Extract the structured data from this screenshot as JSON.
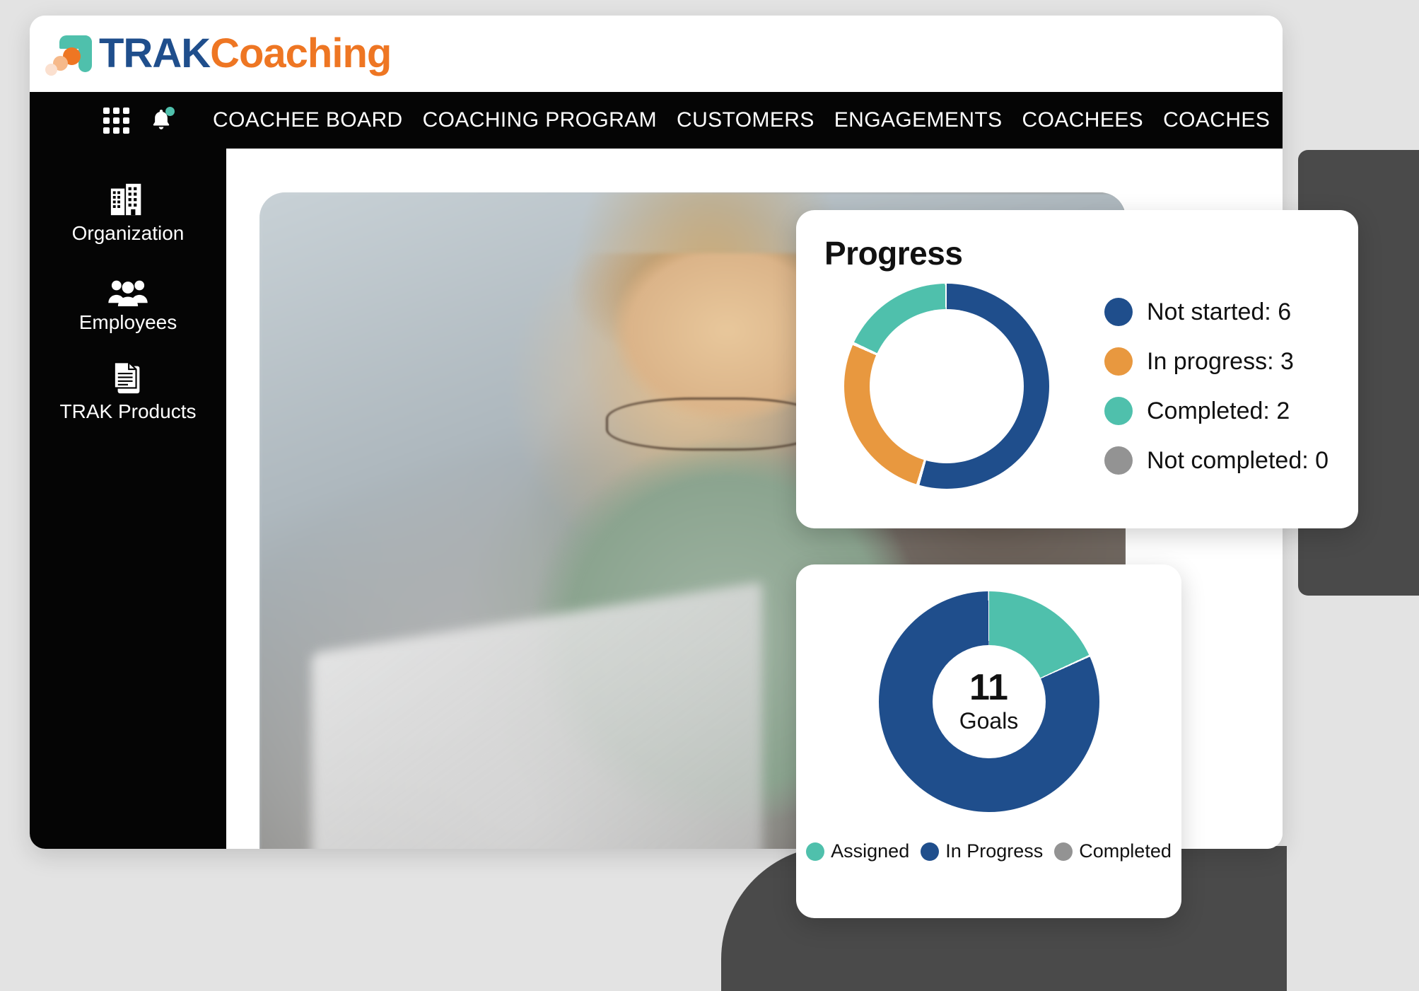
{
  "brand": {
    "name_primary": "TRAK",
    "name_secondary": "Coaching",
    "color_primary": "#1F4E8C",
    "color_secondary": "#EE7623",
    "mark_teal": "#4FC0AC"
  },
  "navbar": {
    "background": "#050505",
    "grid_icon": "apps-grid-icon",
    "bell_icon": "notification-bell-icon",
    "bell_badge_color": "#4FC0AC",
    "links": [
      {
        "label": "COACHEE BOARD"
      },
      {
        "label": "COACHING PROGRAM"
      },
      {
        "label": "CUSTOMERS"
      },
      {
        "label": "ENGAGEMENTS"
      },
      {
        "label": "COACHEES"
      },
      {
        "label": "COACHES"
      }
    ]
  },
  "sidebar": {
    "background": "#050505",
    "items": [
      {
        "label": "Organization",
        "icon": "building-icon"
      },
      {
        "label": "Employees",
        "icon": "people-group-icon"
      },
      {
        "label": "TRAK Products",
        "icon": "documents-icon"
      }
    ]
  },
  "progress_card": {
    "title": "Progress",
    "legend": [
      {
        "label": "Not started: 6",
        "color": "#1F4E8C"
      },
      {
        "label": "In progress: 3",
        "color": "#E8983F"
      },
      {
        "label": "Completed: 2",
        "color": "#4FC0AC"
      },
      {
        "label": "Not completed: 0",
        "color": "#939393"
      }
    ]
  },
  "goals_card": {
    "center_number": "11",
    "center_label": "Goals",
    "legend": [
      {
        "label": "Assigned",
        "color": "#4FC0AC"
      },
      {
        "label": "In Progress",
        "color": "#1F4E8C"
      },
      {
        "label": "Completed",
        "color": "#939393"
      }
    ]
  },
  "chart_data": [
    {
      "type": "pie",
      "id": "progress-donut",
      "title": "Progress",
      "labels": [
        "Not started",
        "In progress",
        "Completed",
        "Not completed"
      ],
      "values": [
        6,
        3,
        2,
        0
      ],
      "colors": [
        "#1F4E8C",
        "#E8983F",
        "#4FC0AC",
        "#939393"
      ],
      "total": 11,
      "donut": true,
      "hole_ratio": 0.75,
      "start_angle_deg": 0,
      "direction": "clockwise",
      "legend_position": "right",
      "legend_entries": [
        "Not started: 6",
        "In progress: 3",
        "Completed: 2",
        "Not completed: 0"
      ]
    },
    {
      "type": "pie",
      "id": "goals-donut",
      "title": "",
      "center_text": "11 Goals",
      "labels": [
        "Assigned",
        "In Progress",
        "Completed"
      ],
      "values": [
        2,
        9,
        0
      ],
      "colors": [
        "#4FC0AC",
        "#1F4E8C",
        "#939393"
      ],
      "total": 11,
      "donut": true,
      "hole_ratio": 0.51,
      "start_angle_deg": 0,
      "direction": "clockwise",
      "legend_position": "bottom",
      "legend_entries": [
        "Assigned",
        "In Progress",
        "Completed"
      ]
    }
  ],
  "page": {
    "background": "#E3E3E3",
    "accent_block_color": "#4A4A4A"
  }
}
